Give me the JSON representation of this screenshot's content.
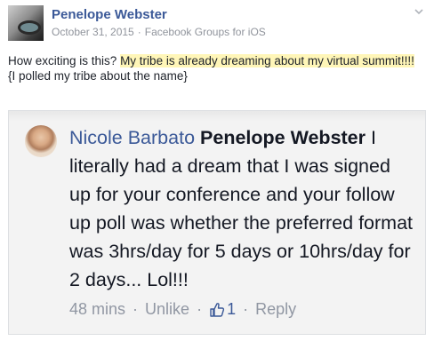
{
  "post": {
    "author": "Penelope Webster",
    "date": "October 31, 2015",
    "separator": "·",
    "source": "Facebook Groups for iOS",
    "text_plain_1": "How exciting is this? ",
    "text_highlight": "My tribe is already dreaming about my virtual summit!!!!",
    "text_line_2": "{I polled my tribe about the name}"
  },
  "comment": {
    "author": "Nicole Barbato",
    "mention": "Penelope Webster",
    "body": " I literally had a dream that I was signed up for your conference and your follow up poll was whether the preferred format was 3hrs/day for 5 days or 10hrs/day for 2 days... Lol!!!",
    "time": "48 mins",
    "sep": "·",
    "unlike": "Unlike",
    "likes": "1",
    "reply": "Reply"
  },
  "colors": {
    "link_blue": "#3b5998",
    "meta_grey": "#90949c",
    "highlight": "#fff6b8"
  }
}
